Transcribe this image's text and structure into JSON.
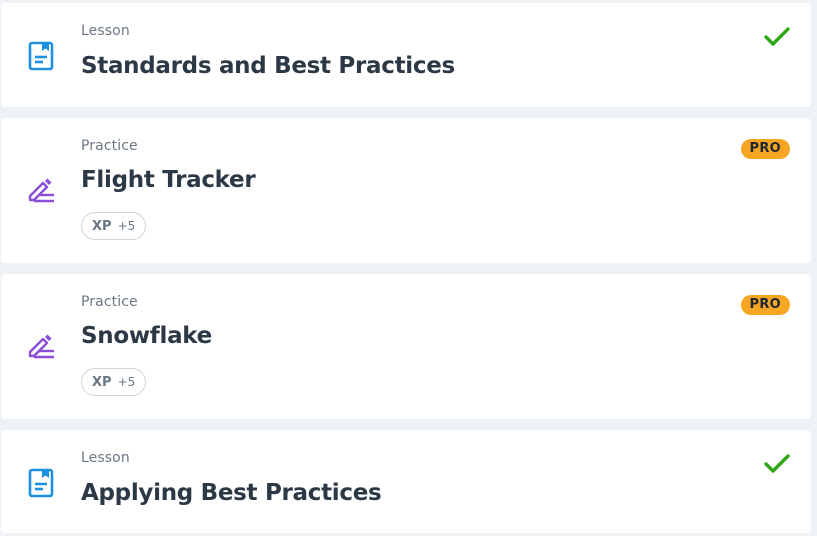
{
  "items": [
    {
      "type": "Lesson",
      "title": "Standards and Best Practices",
      "icon": "lesson-book-icon",
      "status": "completed"
    },
    {
      "type": "Practice",
      "title": "Flight Tracker",
      "icon": "practice-pencil-icon",
      "badge": "PRO",
      "xp_label": "XP",
      "xp_value": "+5"
    },
    {
      "type": "Practice",
      "title": "Snowflake",
      "icon": "practice-pencil-icon",
      "badge": "PRO",
      "xp_label": "XP",
      "xp_value": "+5"
    },
    {
      "type": "Lesson",
      "title": "Applying Best Practices",
      "icon": "lesson-book-icon",
      "status": "completed"
    }
  ],
  "colors": {
    "lesson_icon": "#1e90e0",
    "practice_icon": "#8a4fd6",
    "check": "#2ea815",
    "pro_badge": "#f6a623",
    "title": "#2d3846",
    "muted": "#6b7785",
    "background": "#eef1f5"
  }
}
